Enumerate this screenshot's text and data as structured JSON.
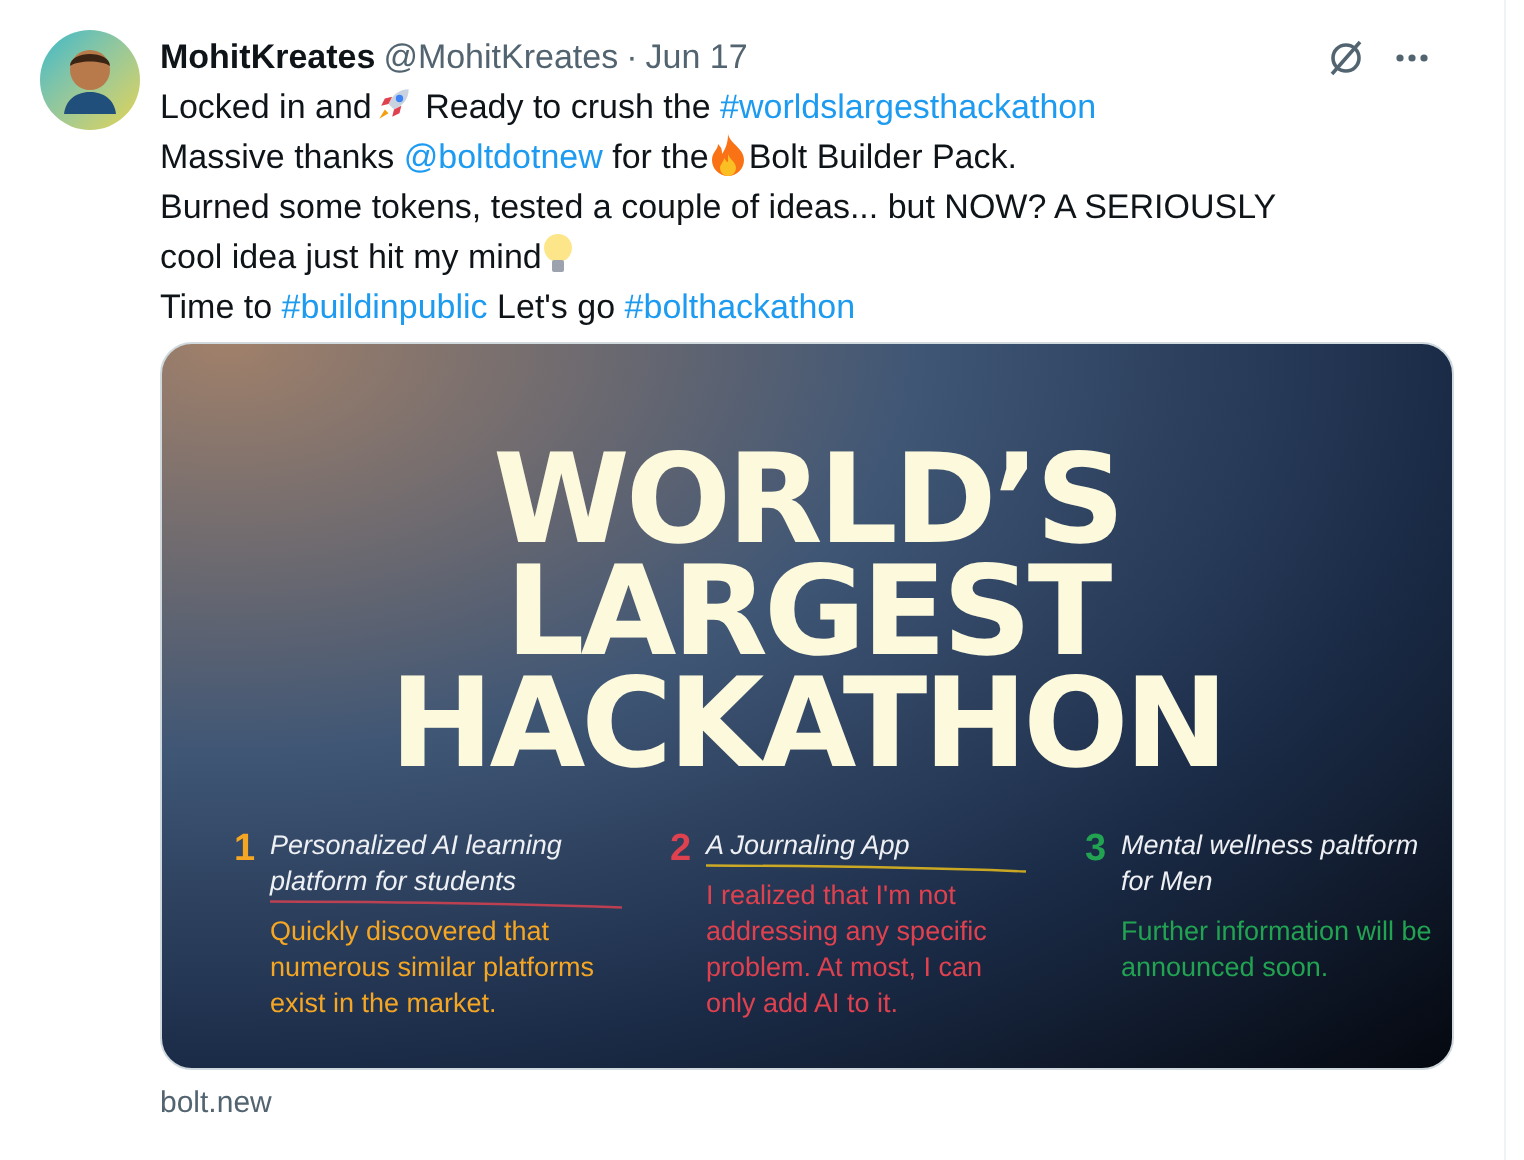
{
  "author": {
    "name": "MohitKreates",
    "handle": "@MohitKreates",
    "separator": "·",
    "date": "Jun 17"
  },
  "lines": [
    [
      {
        "kind": "text",
        "text": "Locked in and"
      },
      {
        "kind": "icon"
      },
      {
        "kind": "text",
        "text": " Ready to crush the "
      },
      {
        "kind": "link",
        "text": "#worldslargesthackathon"
      }
    ],
    [
      {
        "kind": "text",
        "text": "Massive thanks "
      },
      {
        "kind": "link",
        "text": "@boltdotnew"
      },
      {
        "kind": "text",
        "text": " for the"
      },
      {
        "kind": "icon"
      },
      {
        "kind": "text",
        "text": "Bolt Builder Pack."
      }
    ],
    [
      {
        "kind": "text",
        "text": "Burned some tokens, tested a couple of ideas... but NOW? A SERIOUSLY"
      }
    ],
    [
      {
        "kind": "text",
        "text": "cool idea just hit my mind"
      },
      {
        "kind": "icon"
      }
    ],
    [
      {
        "kind": "text",
        "text": "Time to "
      },
      {
        "kind": "link",
        "text": "#buildinpublic"
      },
      {
        "kind": "text",
        "text": " Let's go "
      },
      {
        "kind": "link",
        "text": "#bolthackathon"
      }
    ]
  ],
  "card": {
    "headline": [
      "WORLD’S",
      "LARGEST",
      "HACKATHON"
    ],
    "ideas": [
      {
        "number": "1",
        "color": "#f5a623",
        "title": "Personalized AI learning platform for students",
        "struck": true,
        "note": "Quickly discovered that numerous similar platforms exist in the market."
      },
      {
        "number": "2",
        "color": "#e0414f",
        "title": "A Journaling App",
        "struck": true,
        "note": "I realized that I'm not addressing any specific problem. At most, I can only add AI to it."
      },
      {
        "number": "3",
        "color": "#22a352",
        "title": "Mental wellness paltform for Men",
        "struck": false,
        "note": "Further information will be announced soon."
      }
    ],
    "domain": "bolt.new"
  }
}
